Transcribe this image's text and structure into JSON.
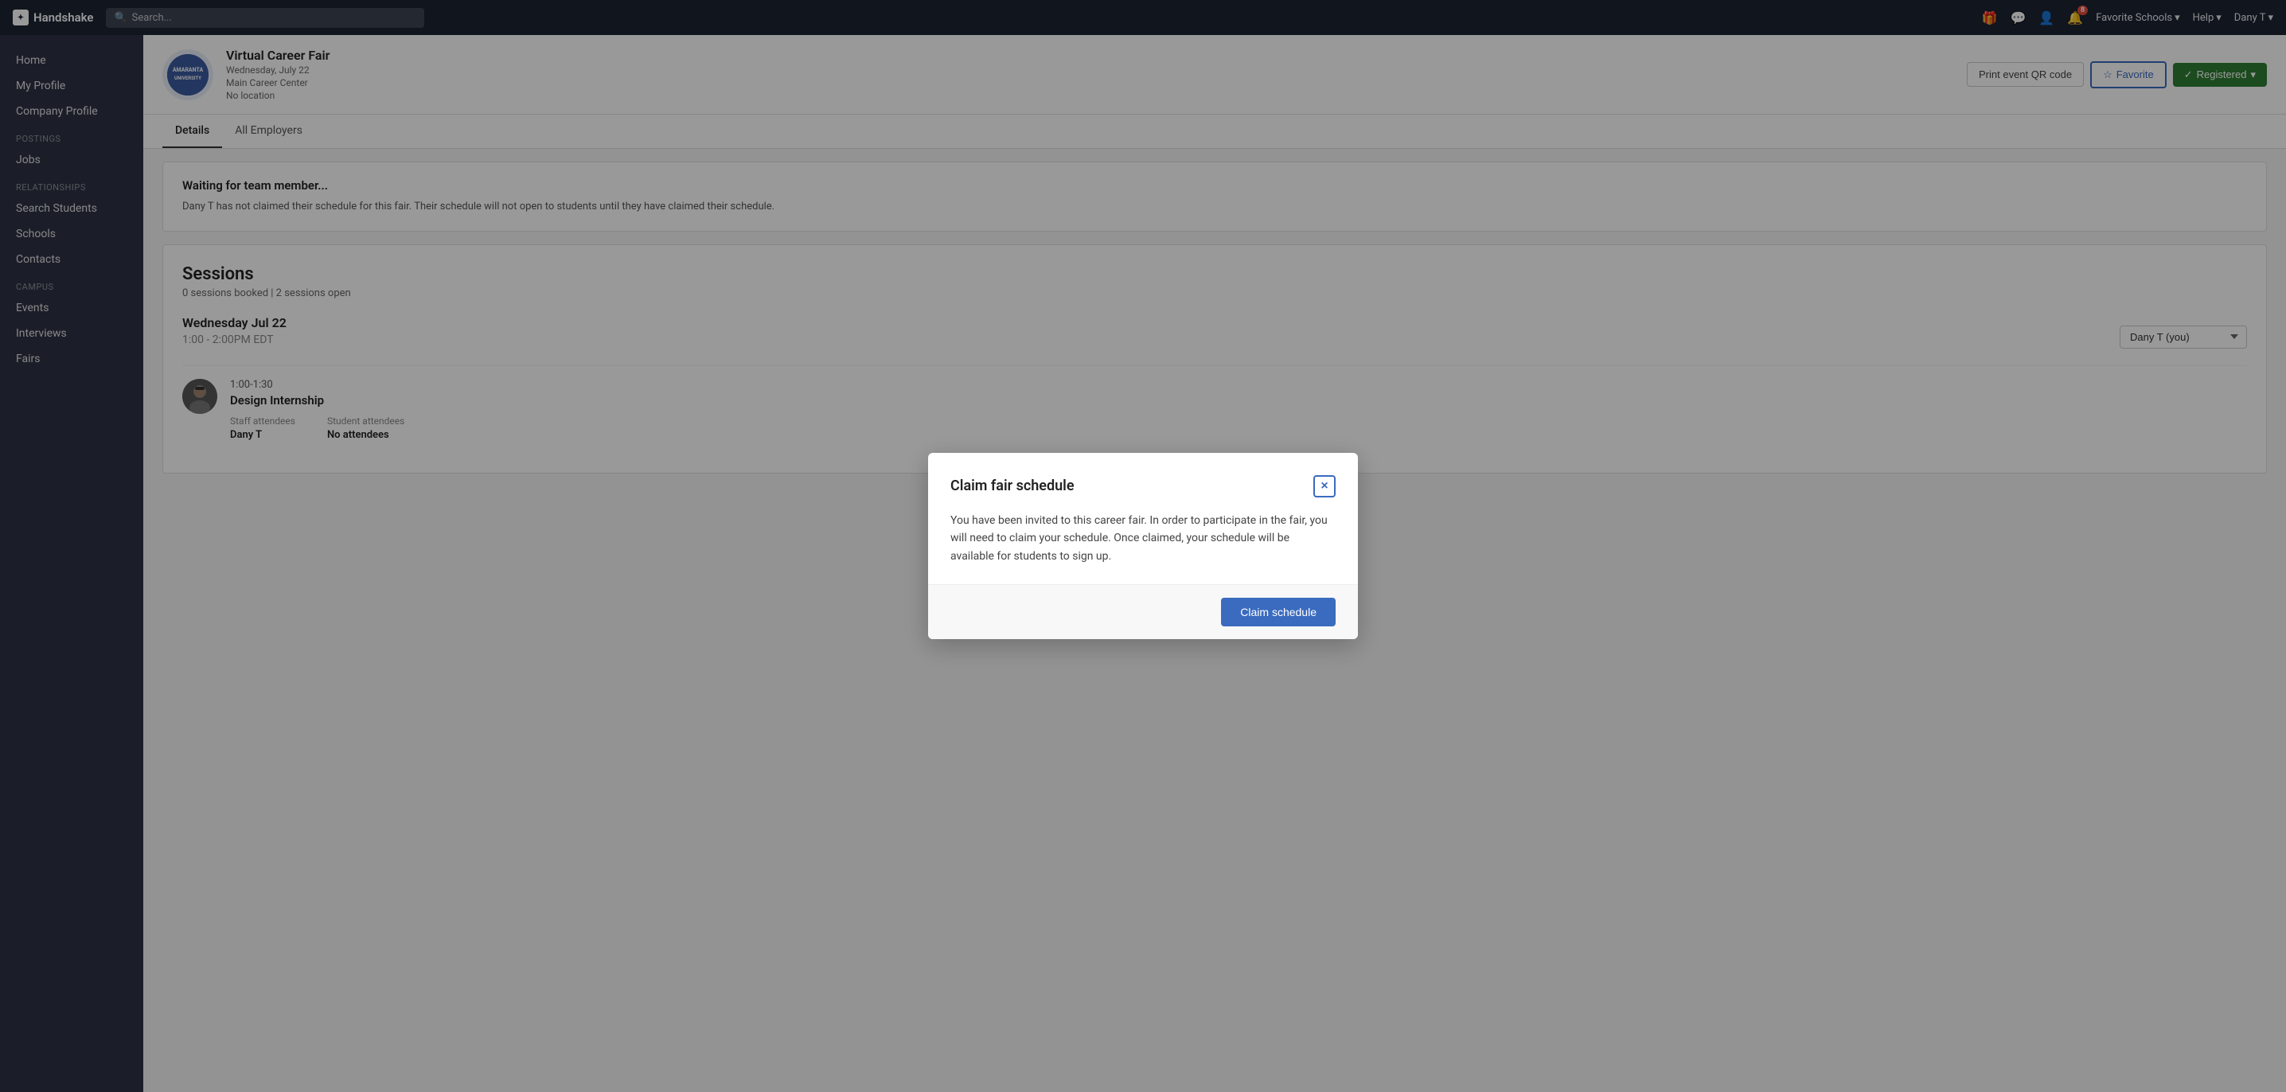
{
  "app": {
    "name": "Handshake",
    "logo_text": "H"
  },
  "topnav": {
    "search_placeholder": "Search...",
    "favorite_schools": "Favorite Schools",
    "help": "Help",
    "user": "Dany T",
    "notification_count": "8"
  },
  "sidebar": {
    "home": "Home",
    "my_profile": "My Profile",
    "company_profile": "Company Profile",
    "postings_label": "Postings",
    "jobs": "Jobs",
    "relationships_label": "Relationships",
    "search_students": "Search Students",
    "schools": "Schools",
    "contacts": "Contacts",
    "campus_label": "Campus",
    "events": "Events",
    "interviews": "Interviews",
    "fairs": "Fairs"
  },
  "event": {
    "logo_text": "AMARANTA\nUNIV.",
    "name": "Virtual Career Fair",
    "date": "Wednesday, July 22",
    "location": "Main Career Center",
    "sublocation": "No location",
    "btn_print": "Print event QR code",
    "btn_favorite": "Favorite",
    "btn_registered": "Registered"
  },
  "tabs": [
    {
      "label": "Details",
      "active": true
    },
    {
      "label": "All Employers",
      "active": false
    }
  ],
  "warning": {
    "title": "Waiting for team member...",
    "text": "Dany T has not claimed their schedule for this fair. Their schedule will not open to students until they have claimed their schedule."
  },
  "sessions": {
    "title": "Sessions",
    "meta": "0 sessions booked | 2 sessions open",
    "date": "Wednesday Jul 22",
    "time": "1:00 - 2:00PM EDT",
    "select_label": "Dany T (you)",
    "entries": [
      {
        "time": "1:00-1:30",
        "job_title": "Design Internship",
        "staff_label": "Staff attendees",
        "staff_value": "Dany T",
        "student_label": "Student attendees",
        "student_value": "No attendees"
      }
    ]
  },
  "modal": {
    "title": "Claim fair schedule",
    "body": "You have been invited to this career fair. In order to participate in the fair, you will need to claim your schedule. Once claimed, your schedule will be available for students to sign up.",
    "btn_claim": "Claim schedule",
    "btn_close": "×"
  }
}
